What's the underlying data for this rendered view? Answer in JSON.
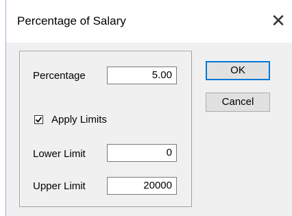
{
  "window": {
    "title": "Percentage of Salary",
    "close_glyph": "✕"
  },
  "form": {
    "percentage_label": "Percentage",
    "percentage_value": "5.00",
    "apply_limits_label": "Apply Limits",
    "apply_limits_checked": true,
    "lower_limit_label": "Lower Limit",
    "lower_limit_value": "0",
    "upper_limit_label": "Upper Limit",
    "upper_limit_value": "20000"
  },
  "buttons": {
    "ok_label": "OK",
    "cancel_label": "Cancel"
  },
  "colors": {
    "accent": "#0078d7",
    "dialog_bg": "#f0f0f0"
  }
}
